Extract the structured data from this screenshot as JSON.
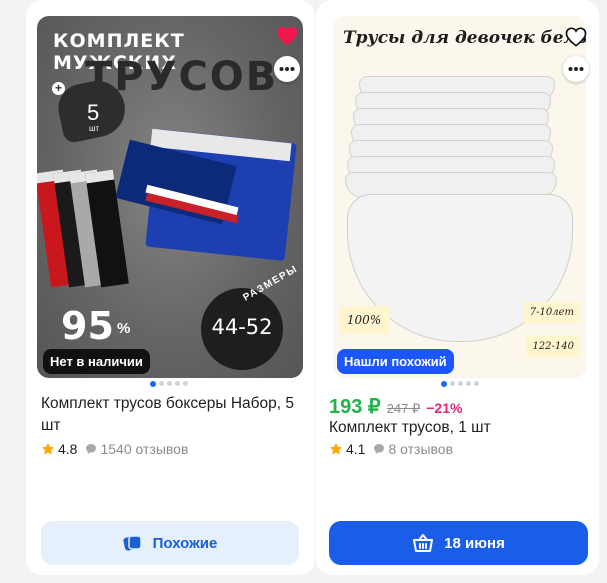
{
  "cards": [
    {
      "image": {
        "banner_top": "КОМПЛЕКТ МУЖСКИХ",
        "banner_big": "ТРУСОВ",
        "pack_count": "5",
        "pack_unit": "шт",
        "percent": "95",
        "percent_sign": "%",
        "sizes_label": "РАЗМЕРЫ",
        "sizes": "44-52",
        "status_badge": "Нет в наличии"
      },
      "favorite": true,
      "gallery": {
        "count": 5,
        "active": 1
      },
      "title": "Комплект трусов боксеры Набор, 5 шт",
      "rating": "4.8",
      "reviews": "1540 отзывов",
      "button_label": "Похожие"
    },
    {
      "image": {
        "title": "Трусы для девочек белые",
        "note_left": "100%",
        "note_age": "7-10лет",
        "note_size": "122-140",
        "tag": "Нашли похожий"
      },
      "favorite": false,
      "gallery": {
        "count": 5,
        "active": 1
      },
      "price": "193 ₽",
      "old_price": "247 ₽",
      "discount": "−21%",
      "title": "Комплект трусов, 1 шт",
      "rating": "4.1",
      "reviews": "8 отзывов",
      "button_label": "18 июня"
    }
  ],
  "colors": {
    "accent": "#1a5ee8",
    "price": "#21b24a",
    "discount": "#e0267a",
    "favorite": "#f1184d",
    "star": "#ffa800"
  },
  "icons": [
    "heart-icon",
    "more-icon",
    "star-icon",
    "reviews-icon",
    "similar-icon",
    "cart-icon",
    "plus-icon"
  ]
}
